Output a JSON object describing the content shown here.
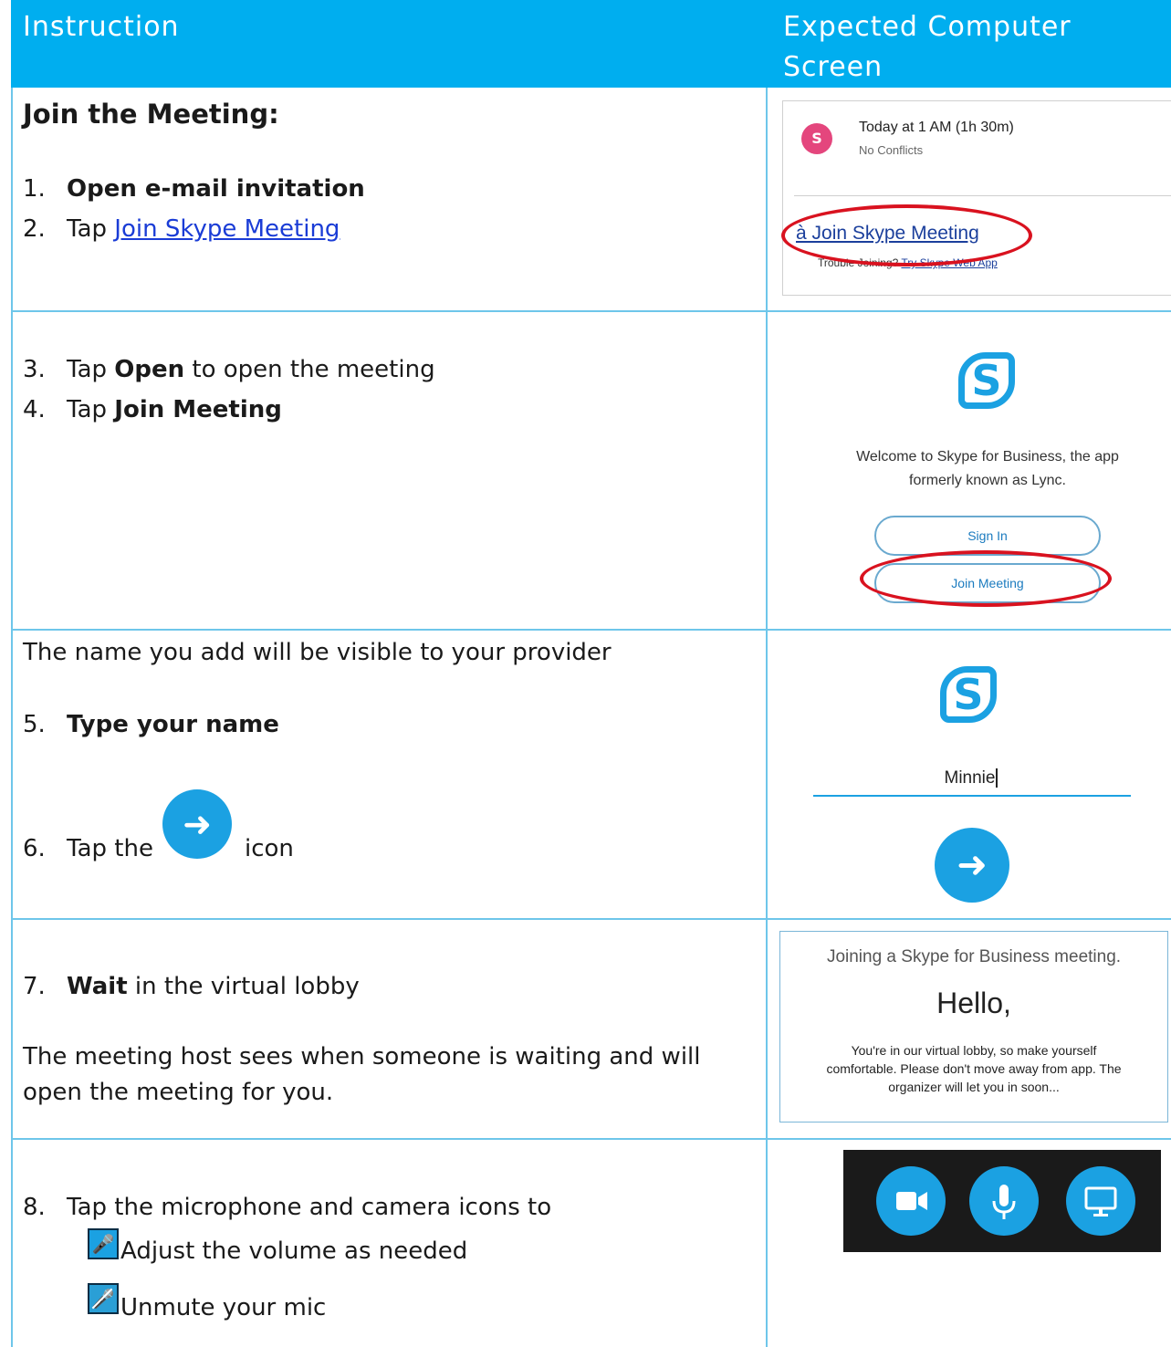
{
  "header": {
    "col1": "Instruction",
    "col2_line1": "Expected Computer",
    "col2_line2": "Screen"
  },
  "row1": {
    "heading": "Join the Meeting:",
    "step1_num": "1.",
    "step1_text": "Open e-mail invitation",
    "step2_num": "2.",
    "step2_prefix": "Tap ",
    "step2_link": "Join Skype Meeting",
    "shot": {
      "avatar_letter": "S",
      "time": "Today at 1 AM (1h 30m)",
      "conflicts": "No Conflicts",
      "join_link": "à Join Skype Meeting",
      "trouble_prefix": "Trouble Joining? ",
      "trouble_link": "Try Skype Web App"
    }
  },
  "row2": {
    "step3_num": "3.",
    "step3_prefix": "Tap ",
    "step3_bold": "Open",
    "step3_suffix": " to open the meeting",
    "step4_num": "4.",
    "step4_prefix": "Tap ",
    "step4_bold": "Join Meeting",
    "shot": {
      "logo_letter": "S",
      "welcome_line1": "Welcome to Skype for Business, the app",
      "welcome_line2": "formerly known as Lync.",
      "signin_label": "Sign In",
      "join_label": "Join Meeting"
    }
  },
  "row3": {
    "intro": "The name you add will be visible to your provider",
    "step5_num": "5.",
    "step5_bold": "Type your name",
    "step6_num": "6.",
    "step6_prefix": "Tap the",
    "step6_suffix": "icon",
    "shot": {
      "logo_letter": "S",
      "name_value": "Minnie"
    }
  },
  "row4": {
    "step7_num": "7.",
    "step7_bold": "Wait",
    "step7_suffix": " in the virtual lobby",
    "note_line1": "The meeting host sees when someone is waiting and will",
    "note_line2": "open the meeting for you.",
    "shot": {
      "title": "Joining a Skype for Business meeting.",
      "hello": "Hello,",
      "msg_line1": "You're in our virtual lobby, so make yourself",
      "msg_line2": "comfortable. Please don't move away from app. The",
      "msg_line3": "organizer will let you in soon..."
    }
  },
  "row5": {
    "step8_num": "8.",
    "step8_text": "Tap the microphone and camera icons to",
    "bullet1": "Adjust the volume as needed",
    "bullet2": "Unmute your mic"
  },
  "colors": {
    "header_bg": "#00aeef",
    "accent": "#1ba1e2",
    "highlight_oval": "#d9121f",
    "link": "#1a3cd6"
  },
  "icons": [
    "skype-logo-icon",
    "arrow-right-icon",
    "video-camera-icon",
    "microphone-icon",
    "screen-share-icon",
    "mic-muted-icon"
  ]
}
